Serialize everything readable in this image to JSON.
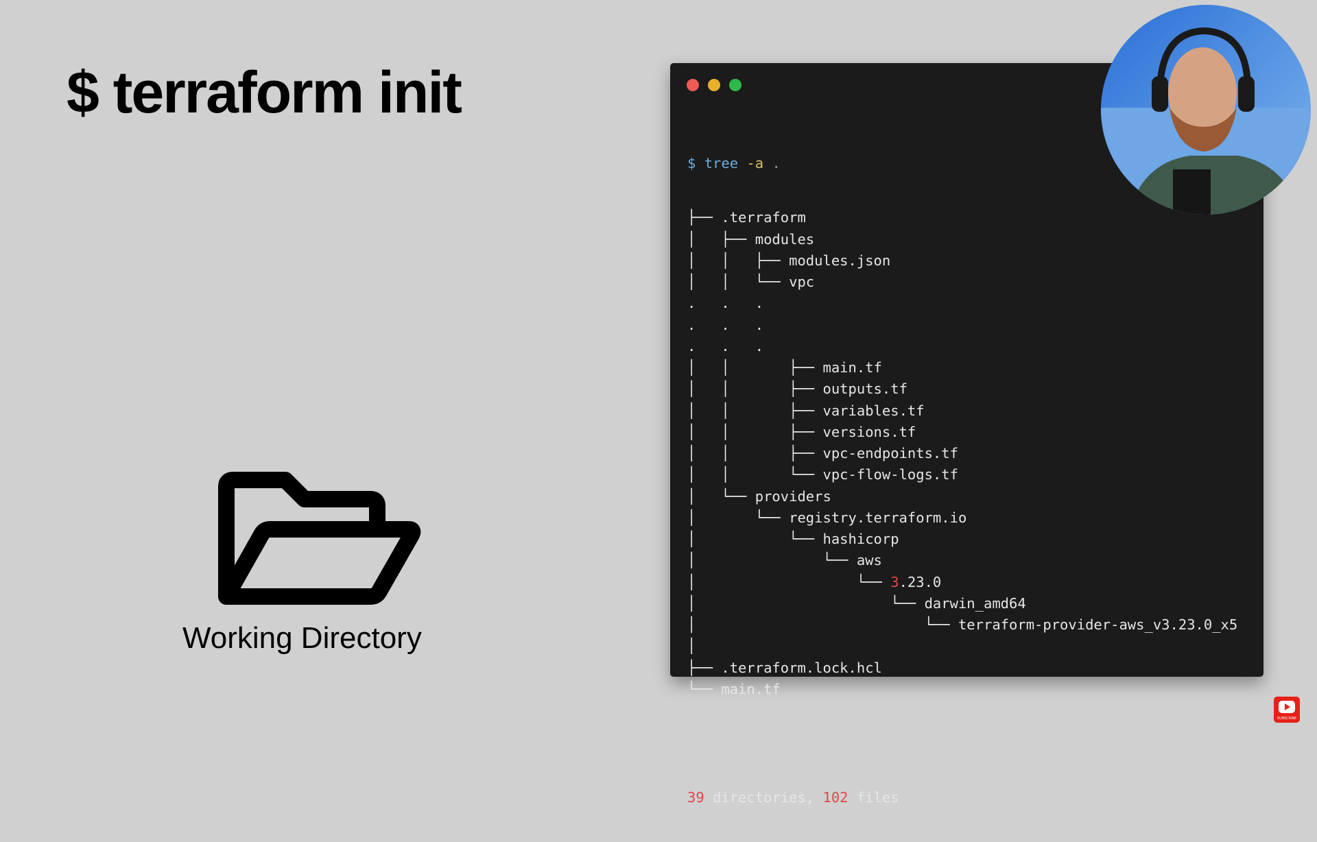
{
  "slide": {
    "title": "$ terraform init",
    "folder_label": "Working Directory"
  },
  "terminal": {
    "prompt_symbol": "$",
    "command": "tree",
    "flag": "-a",
    "arg": ".",
    "tree": [
      {
        "prefix": "├── ",
        "name": ".terraform"
      },
      {
        "prefix": "│   ├── ",
        "name": "modules"
      },
      {
        "prefix": "│   │   ├── ",
        "name": "modules.json"
      },
      {
        "prefix": "│   │   └── ",
        "name": "vpc"
      },
      {
        "prefix": ".   .   .",
        "name": ""
      },
      {
        "prefix": ".   .   .",
        "name": ""
      },
      {
        "prefix": ".   .   .",
        "name": ""
      },
      {
        "prefix": "│   │       ├── ",
        "name": "main.tf"
      },
      {
        "prefix": "│   │       ├── ",
        "name": "outputs.tf"
      },
      {
        "prefix": "│   │       ├── ",
        "name": "variables.tf"
      },
      {
        "prefix": "│   │       ├── ",
        "name": "versions.tf"
      },
      {
        "prefix": "│   │       ├── ",
        "name": "vpc-endpoints.tf"
      },
      {
        "prefix": "│   │       └── ",
        "name": "vpc-flow-logs.tf"
      },
      {
        "prefix": "│   └── ",
        "name": "providers"
      },
      {
        "prefix": "│       └── ",
        "name": "registry.terraform.io"
      },
      {
        "prefix": "│           └── ",
        "name": "hashicorp"
      },
      {
        "prefix": "│               └── ",
        "name": "aws"
      },
      {
        "prefix": "│                   └── ",
        "name": "3.23.0",
        "accent": "3"
      },
      {
        "prefix": "│                       └── ",
        "name": "darwin_amd64"
      },
      {
        "prefix": "│                           └── ",
        "name": "terraform-provider-aws_v3.23.0_x5"
      },
      {
        "prefix": "│",
        "name": ""
      },
      {
        "prefix": "├── ",
        "name": ".terraform.lock.hcl"
      },
      {
        "prefix": "└── ",
        "name": "main.tf"
      }
    ],
    "summary": {
      "dir_count": "39",
      "dir_label": " directories, ",
      "file_count": "102",
      "file_label": " files"
    }
  },
  "colors": {
    "background": "#d0d0d0",
    "terminal_bg": "#1b1b1b",
    "prompt": "#6aaee0",
    "flag": "#d7c45a",
    "number": "#e0474c"
  },
  "icons": [
    "folder-open-icon",
    "window-close-dot",
    "window-minimize-dot",
    "window-zoom-dot",
    "youtube-subscribe-icon"
  ],
  "overlay": {
    "webcam": "presenter-webcam",
    "subscribe_text": "SUBSCRIBE"
  }
}
